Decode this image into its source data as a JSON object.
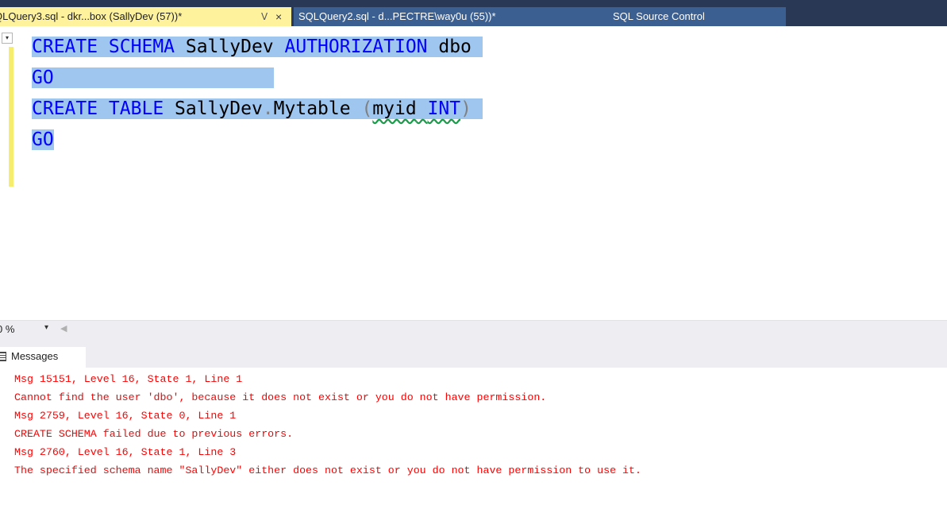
{
  "tabs": [
    {
      "title": "QLQuery3.sql - dkr...box (SallyDev (57))*",
      "pin": "ⴸ",
      "close": "×",
      "active": true
    },
    {
      "title": "SQLQuery2.sql - d...PECTRE\\way0u (55))*"
    },
    {
      "title": "SQL Source Control"
    }
  ],
  "editor": {
    "lines": [
      {
        "t1": "CREATE SCHEMA",
        "t2": " SallyDev ",
        "t3": "AUTHORIZATION",
        "t4": " dbo"
      },
      {
        "t1": "GO"
      },
      {
        "t1": "CREATE TABLE",
        "t2": " SallyDev",
        "t3": ".",
        "t4": "Mytable ",
        "t5": "(",
        "t6": "myid",
        "t7": " ",
        "t8": "INT",
        "t9": ")"
      },
      {
        "t1": "GO"
      }
    ],
    "colors": {
      "keyword": "#0000ff",
      "selection": "#9ec6ef",
      "change_bar": "#f6ec6e"
    }
  },
  "zoom": {
    "value": "0 %"
  },
  "results": {
    "tab_label": "Messages",
    "messages": [
      "Msg 15151, Level 16, State 1, Line 1",
      "Cannot find the user 'dbo', because it does not exist or you do not have permission.",
      "Msg 2759, Level 16, State 0, Line 1",
      "CREATE SCHEMA failed due to previous errors.",
      "Msg 2760, Level 16, State 1, Line 3",
      "The specified schema name \"SallyDev\" either does not exist or you do not have permission to use it."
    ],
    "error_color": "#ff0000"
  }
}
